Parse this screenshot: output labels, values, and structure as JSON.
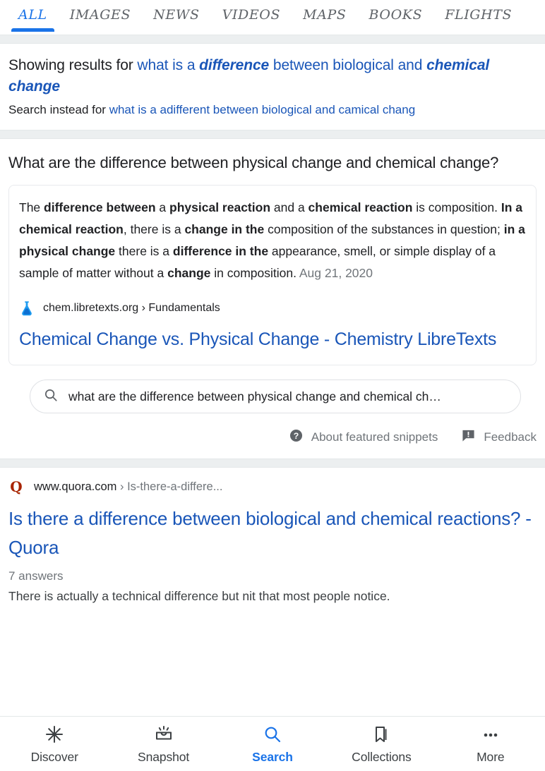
{
  "tabs": [
    {
      "label": "ALL",
      "active": true
    },
    {
      "label": "IMAGES",
      "active": false
    },
    {
      "label": "NEWS",
      "active": false
    },
    {
      "label": "VIDEOS",
      "active": false
    },
    {
      "label": "MAPS",
      "active": false
    },
    {
      "label": "BOOKS",
      "active": false
    },
    {
      "label": "FLIGHTS",
      "active": false
    }
  ],
  "spell_correction": {
    "showing_prefix": "Showing results for ",
    "corrected_plain_1": "what is a ",
    "corrected_bold_1": "difference",
    "corrected_plain_2": " between biological and ",
    "corrected_bold_2": "chemical change",
    "instead_prefix": "Search instead for ",
    "instead_query": "what is a adifferent between biological and camical chang"
  },
  "featured_snippet": {
    "question": "What are the difference between physical change and chemical change?",
    "body": {
      "t1": "The ",
      "b1": "difference between",
      "t2": " a ",
      "b2": "physical reaction",
      "t3": " and a ",
      "b3": "chemical reaction",
      "t4": " is composition. ",
      "b4": "In a chemical reaction",
      "t5": ", there is a ",
      "b5": "change in the",
      "t6": " composition of the substances in question; ",
      "b6": "in a physical change",
      "t7": " there is a ",
      "b7": "difference in the",
      "t8": " appearance, smell, or simple display of a sample of matter without a ",
      "b8": "change",
      "t9": " in composition. ",
      "date": "Aug 21, 2020"
    },
    "source_domain": "chem.libretexts.org",
    "source_separator": " › ",
    "source_path": "Fundamentals",
    "source_icon": "flask-icon",
    "title": "Chemical Change vs. Physical Change - Chemistry LibreTexts"
  },
  "refinement_pill": {
    "icon": "search-icon",
    "text": "what are the difference between physical change and chemical ch…"
  },
  "feedback_row": {
    "about_icon": "help-circle-icon",
    "about_label": "About featured snippets",
    "feedback_icon": "feedback-bubble-icon",
    "feedback_label": "Feedback"
  },
  "organic_result": {
    "favicon": "quora-q-icon",
    "favicon_letter": "Q",
    "domain": "www.quora.com",
    "separator": " › ",
    "crumb": "Is-there-a-differe...",
    "title": "Is there a difference between biological and chemical reactions? - Quora",
    "meta": "7 answers",
    "description": "There is actually a technical difference but nit that most people notice."
  },
  "bottom_nav": [
    {
      "label": "Discover",
      "icon": "asterisk-icon",
      "active": false
    },
    {
      "label": "Snapshot",
      "icon": "snapshot-tray-icon",
      "active": false
    },
    {
      "label": "Search",
      "icon": "search-icon",
      "active": true
    },
    {
      "label": "Collections",
      "icon": "bookmark-icon",
      "active": false
    },
    {
      "label": "More",
      "icon": "more-dots-icon",
      "active": false
    }
  ],
  "colors": {
    "link_blue": "#1a56b8",
    "accent_blue": "#1a73e8",
    "text_primary": "#202124",
    "text_secondary": "#70757a",
    "separator": "#eceff0",
    "quora_red": "#a82400"
  }
}
